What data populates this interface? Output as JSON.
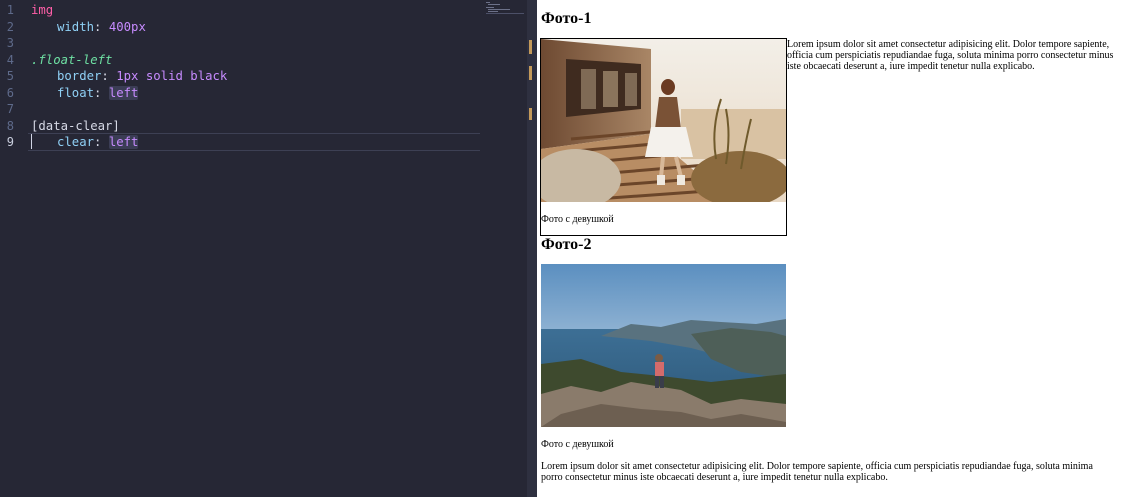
{
  "editor": {
    "lines": [
      {
        "n": "1",
        "tokens": [
          {
            "t": "img",
            "c": "tok-tag"
          }
        ]
      },
      {
        "n": "2",
        "indent": true,
        "tokens": [
          {
            "t": "width",
            "c": "tok-prop"
          },
          {
            "t": ": ",
            "c": "tok-punc"
          },
          {
            "t": "400px",
            "c": "tok-num"
          }
        ]
      },
      {
        "n": "3",
        "tokens": []
      },
      {
        "n": "4",
        "tokens": [
          {
            "t": ".float-left",
            "c": "tok-class"
          }
        ]
      },
      {
        "n": "5",
        "indent": true,
        "tokens": [
          {
            "t": "border",
            "c": "tok-prop"
          },
          {
            "t": ": ",
            "c": "tok-punc"
          },
          {
            "t": "1px",
            "c": "tok-num"
          },
          {
            "t": " ",
            "c": "tok-punc"
          },
          {
            "t": "solid",
            "c": "tok-kw"
          },
          {
            "t": " ",
            "c": "tok-punc"
          },
          {
            "t": "black",
            "c": "tok-kw"
          }
        ]
      },
      {
        "n": "6",
        "indent": true,
        "tokens": [
          {
            "t": "float",
            "c": "tok-prop"
          },
          {
            "t": ": ",
            "c": "tok-punc"
          },
          {
            "t": "left",
            "c": "tok-kw",
            "hl": true
          }
        ]
      },
      {
        "n": "7",
        "tokens": []
      },
      {
        "n": "8",
        "tokens": [
          {
            "t": "[data-clear]",
            "c": "tok-attr"
          }
        ]
      },
      {
        "n": "9",
        "indent": true,
        "active": true,
        "tokens": [
          {
            "t": "clear",
            "c": "tok-prop"
          },
          {
            "t": ": ",
            "c": "tok-punc"
          },
          {
            "t": "left",
            "c": "tok-kw",
            "hl": true
          }
        ]
      }
    ]
  },
  "preview": {
    "heading1": "Фото-1",
    "caption1": "Фото с девушкой",
    "text1": "Lorem ipsum dolor sit amet consectetur adipisicing elit. Dolor tempore sapiente, officia cum perspiciatis repudiandae fuga, soluta minima porro consectetur minus iste obcaecati deserunt a, iure impedit tenetur nulla explicabo.",
    "heading2": "Фото-2",
    "caption2": "Фото с девушкой",
    "text2": "Lorem ipsum dolor sit amet consectetur adipisicing elit. Dolor tempore sapiente, officia cum perspiciatis repudiandae fuga, soluta minima porro consectetur minus iste obcaecati deserunt a, iure impedit tenetur nulla explicabo."
  },
  "colors": {
    "editor_bg": "#262735",
    "tag": "#ff5ea8",
    "property": "#8fd0f5",
    "value": "#c78bff",
    "class_selector": "#6ee0a3"
  },
  "icons": [
    "minimap",
    "scrollbar"
  ]
}
